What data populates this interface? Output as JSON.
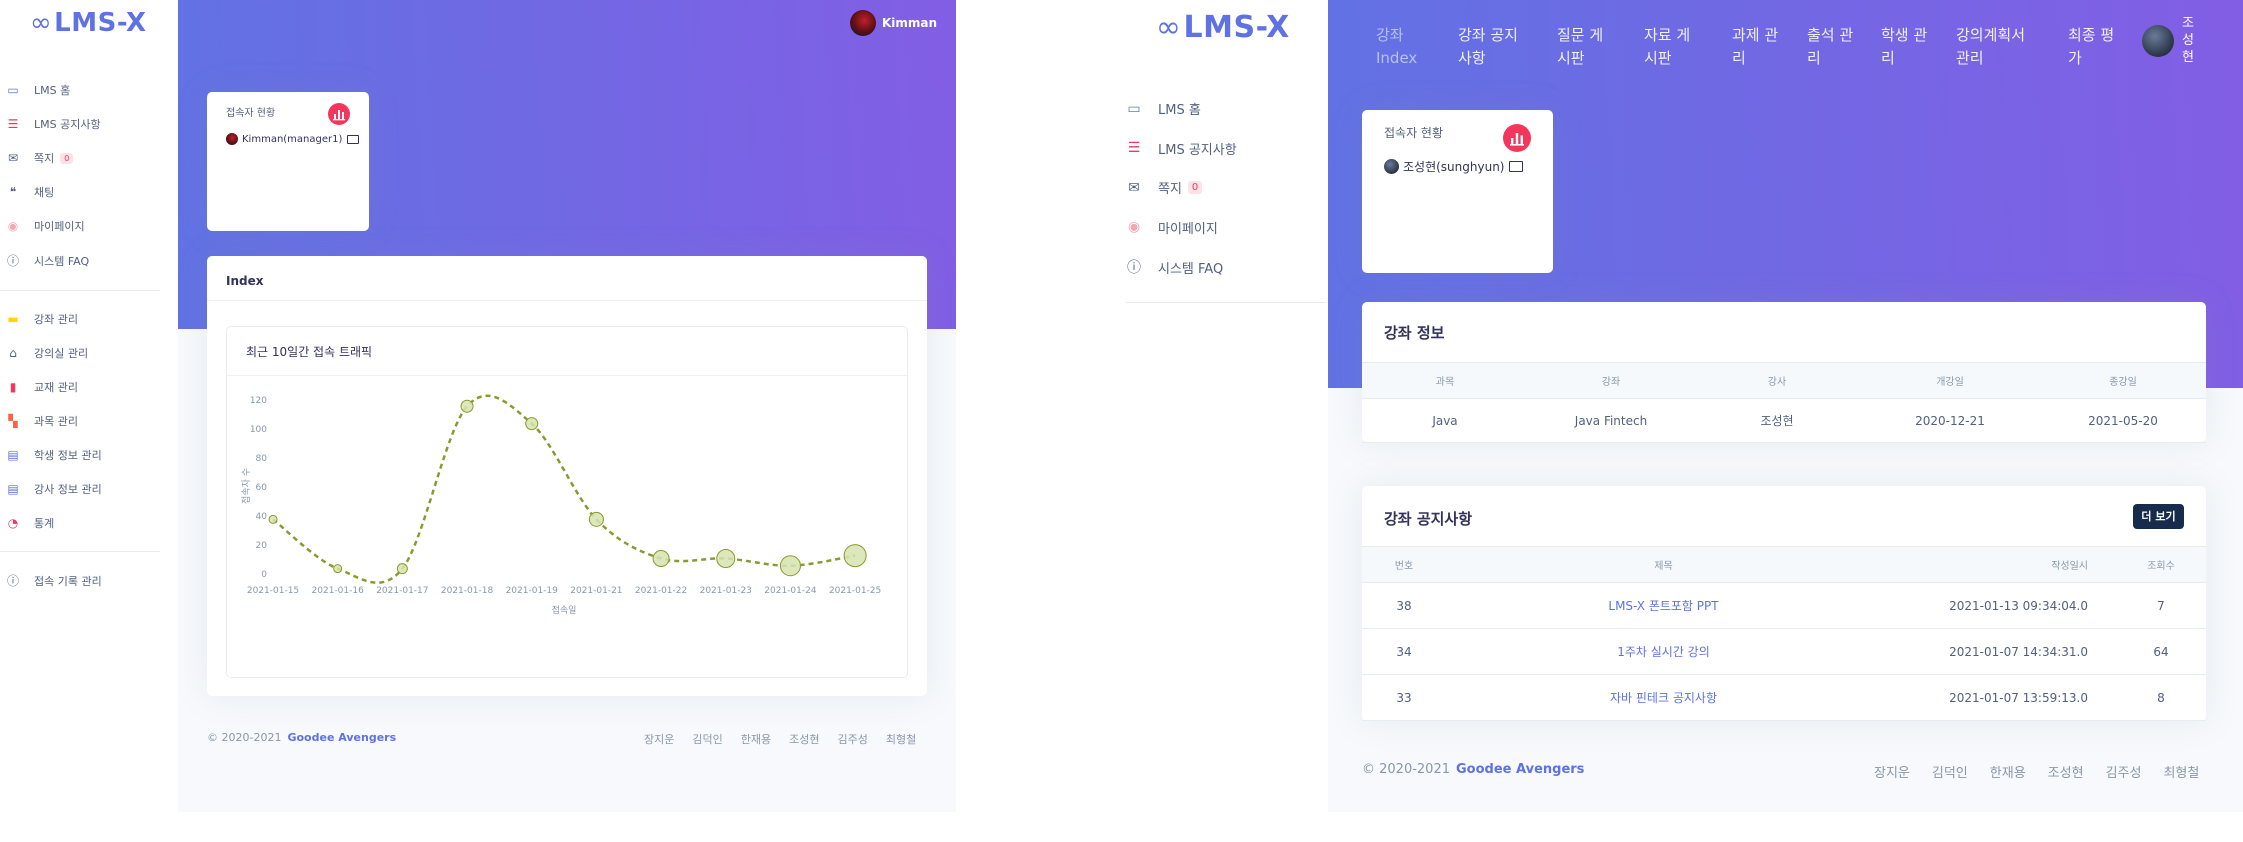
{
  "left": {
    "logo": "LMS-X",
    "user_name": "Kimman",
    "menu_primary": [
      {
        "icon": "monitor-icon",
        "label": "LMS 홈",
        "color": "#5e72e4"
      },
      {
        "icon": "list-icon",
        "label": "LMS 공지사항",
        "color": "#f5365c"
      },
      {
        "icon": "envelope-icon",
        "label": "쪽지",
        "badge": "0",
        "color": "#525f7f"
      },
      {
        "icon": "chat-icon",
        "label": "채팅",
        "color": "#525f7f"
      },
      {
        "icon": "user-circle-icon",
        "label": "마이페이지",
        "color": "#f3a4b5"
      },
      {
        "icon": "question-icon",
        "label": "시스템 FAQ",
        "color": "#525f7f"
      }
    ],
    "menu_admin": [
      {
        "icon": "chalkboard-icon",
        "label": "강좌 관리",
        "color": "#ffd600"
      },
      {
        "icon": "building-icon",
        "label": "강의실 관리",
        "color": "#525f7f"
      },
      {
        "icon": "book-icon",
        "label": "교재 관리",
        "color": "#f5365c"
      },
      {
        "icon": "open-book-icon",
        "label": "과목 관리",
        "color": "#fb6340"
      },
      {
        "icon": "id-card-icon",
        "label": "학생 정보 관리",
        "color": "#5e72e4"
      },
      {
        "icon": "id-card-icon",
        "label": "강사 정보 관리",
        "color": "#5e72e4"
      },
      {
        "icon": "pie-chart-icon",
        "label": "통계",
        "color": "#f5365c"
      }
    ],
    "menu_extra": [
      {
        "icon": "question-icon",
        "label": "접속 기록 관리",
        "color": "#525f7f"
      }
    ],
    "stat_card": {
      "title": "접속자 현황",
      "user": "Kimman(manager1)"
    },
    "index_card": {
      "title": "Index"
    },
    "chart_card": {
      "title": "최근 10일간 접속 트래픽"
    },
    "footer": {
      "copyright": "© 2020-2021",
      "team": "Goodee Avengers",
      "links": [
        "장지운",
        "김덕인",
        "한재용",
        "조성현",
        "김주성",
        "최형철"
      ]
    }
  },
  "right": {
    "logo": "LMS-X",
    "user_name": "조성현",
    "menu": [
      {
        "icon": "monitor-icon",
        "label": "LMS 홈",
        "color": "#5e72e4"
      },
      {
        "icon": "list-icon",
        "label": "LMS 공지사항",
        "color": "#f5365c"
      },
      {
        "icon": "envelope-icon",
        "label": "쪽지",
        "badge": "0",
        "color": "#525f7f"
      },
      {
        "icon": "user-circle-icon",
        "label": "마이페이지",
        "color": "#f3a4b5"
      },
      {
        "icon": "question-icon",
        "label": "시스템 FAQ",
        "color": "#525f7f"
      }
    ],
    "top_nav": [
      "강좌 Index",
      "강좌 공지사항",
      "질문 게시판",
      "자료 게시판",
      "과제 관리",
      "출석 관리",
      "학생 관리",
      "강의계획서 관리",
      "최종 평가"
    ],
    "top_nav_lines": [
      [
        "강좌",
        "Index"
      ],
      [
        "강좌 공지",
        "사항"
      ],
      [
        "질문 게",
        "시판"
      ],
      [
        "자료 게",
        "시판"
      ],
      [
        "과제 관",
        "리"
      ],
      [
        "출석 관",
        "리"
      ],
      [
        "학생 관",
        "리"
      ],
      [
        "강의계획서",
        "관리"
      ],
      [
        "최종 평",
        "가"
      ]
    ],
    "stat_card": {
      "title": "접속자 현황",
      "user": "조성현(sunghyun)"
    },
    "course_info": {
      "title": "강좌 정보",
      "headers": [
        "과목",
        "강좌",
        "강사",
        "개강일",
        "종강일"
      ],
      "row": [
        "Java",
        "Java Fintech",
        "조성현",
        "2020-12-21",
        "2021-05-20"
      ]
    },
    "notices": {
      "title": "강좌 공지사항",
      "more_button": "더 보기",
      "headers": [
        "번호",
        "제목",
        "작성일시",
        "조회수"
      ],
      "rows": [
        [
          "38",
          "LMS-X 폰트포함 PPT",
          "2021-01-13 09:34:04.0",
          "7"
        ],
        [
          "34",
          "1주차 실시간 강의",
          "2021-01-07 14:34:31.0",
          "64"
        ],
        [
          "33",
          "자바 핀테크 공지사항",
          "2021-01-07 13:59:13.0",
          "8"
        ]
      ]
    },
    "footer": {
      "copyright": "© 2020-2021",
      "team": "Goodee Avengers",
      "links": [
        "장지운",
        "김덕인",
        "한재용",
        "조성현",
        "김주성",
        "최형철"
      ]
    }
  },
  "chart_data": {
    "type": "line",
    "title": "",
    "xlabel": "접속일",
    "ylabel": "접속자 수",
    "categories": [
      "2021-01-15",
      "2021-01-16",
      "2021-01-17",
      "2021-01-18",
      "2021-01-19",
      "2021-01-21",
      "2021-01-22",
      "2021-01-23",
      "2021-01-24",
      "2021-01-25"
    ],
    "values": [
      37,
      3,
      3,
      115,
      103,
      37,
      10,
      10,
      5,
      12
    ],
    "bubble_radius": [
      4,
      4,
      5,
      6,
      6,
      7,
      8,
      9,
      10,
      11
    ],
    "ylim": [
      0,
      120
    ],
    "yticks": [
      0,
      20,
      40,
      60,
      80,
      100,
      120
    ],
    "line_color": "#8a9a2e",
    "fill_color": "#d7e3b0",
    "line_style": "dashed",
    "grid": false
  }
}
